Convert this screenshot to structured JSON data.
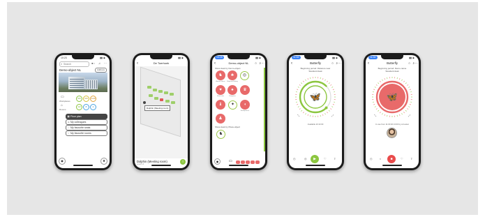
{
  "colors": {
    "accent_green": "#8cc63f",
    "accent_red": "#e86a6a",
    "background": "#e6e6e6"
  },
  "phone1": {
    "status_time": "10:23",
    "search_placeholder": "Search",
    "location_title": "Demo-object NL",
    "location_button": "Address",
    "labels": {
      "workplaces": "Workplaces",
      "rooms": "Rooms"
    },
    "circles_row1": [
      "5/6",
      "6/8",
      "1/30"
    ],
    "circles_row2": [
      "1/2",
      "8",
      "2"
    ],
    "menu": [
      {
        "label": "Floor plan",
        "icon": "floorplan-icon"
      },
      {
        "label": "My colleagues",
        "icon": "people-icon"
      },
      {
        "label": "My favourite seats",
        "icon": "heart-icon"
      },
      {
        "label": "My favourite rooms",
        "icon": "heart-icon"
      }
    ]
  },
  "phone2": {
    "title": "De Toerhoek",
    "tooltip": "Dolphin (Meeting room)",
    "room_name": "Dolphin (Meeting room)",
    "room_sub": "Level 0.4"
  },
  "phone3": {
    "status_time": "10:25",
    "title": "Demo-object NL",
    "section1": "Show desk by Demo-object",
    "section2": "Show desk by Place-object",
    "avatar_labels": [
      "Animal Horse",
      "Elephant Riding",
      "Headset",
      "Heart-rate",
      "Kangaroo",
      "Lion Figure",
      "Giraffe",
      "Bee Insect",
      "Headphones",
      "Squirrel",
      "Horse"
    ]
  },
  "phone4": {
    "status_time": "11:02",
    "title": "Butterfly",
    "sub1": "Beginning period: Distance near",
    "sub2": "Standard desk",
    "available": "Available till 13:00",
    "progress": 0.75
  },
  "phone5": {
    "status_time": "11:02",
    "title": "Butterfly",
    "sub1": "Beginning period: Demo-name",
    "sub2": "Standard desk",
    "occupied": "In use from 11:00 till 13:00 by a booker",
    "progress": 1.0
  }
}
